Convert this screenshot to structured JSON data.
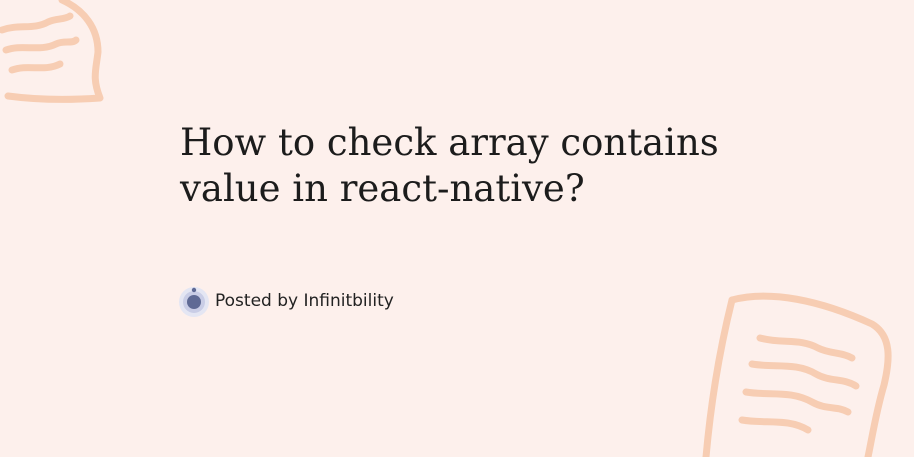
{
  "post": {
    "title": "How to check array contains value in react-native?",
    "byline": "Posted by Infinitbility"
  },
  "icons": {
    "avatar": "author-avatar-icon",
    "decoration_top_left": "note-doodle-icon",
    "decoration_bottom_right": "note-doodle-icon"
  },
  "colors": {
    "background": "#fdf0ec",
    "doodle": "#f6c8aa",
    "title_text": "#1c1c1c",
    "avatar_ring": "#c9cde6",
    "avatar_core": "#5f6a95"
  }
}
